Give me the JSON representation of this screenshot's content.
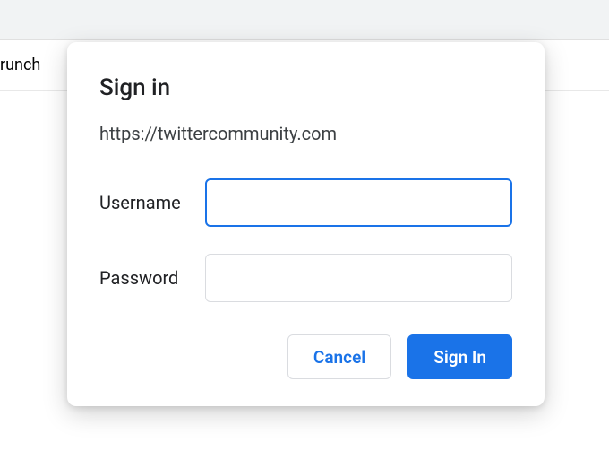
{
  "header": {
    "tab_fragment": "runch"
  },
  "dialog": {
    "title": "Sign in",
    "url": "https://twittercommunity.com",
    "fields": {
      "username": {
        "label": "Username",
        "value": ""
      },
      "password": {
        "label": "Password",
        "value": ""
      }
    },
    "buttons": {
      "cancel": "Cancel",
      "signin": "Sign In"
    }
  }
}
